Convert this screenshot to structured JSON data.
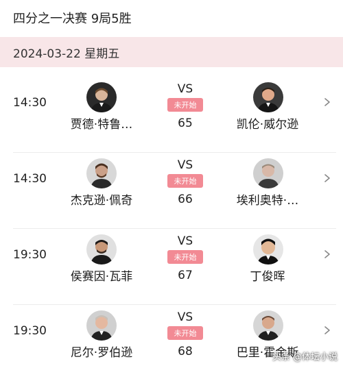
{
  "header": {
    "title": "四分之一决赛 9局5胜"
  },
  "date_bar": {
    "label": "2024-03-22 星期五"
  },
  "matches": [
    {
      "time": "14:30",
      "left_player": "贾德·特鲁…",
      "right_player": "凯伦·威尔逊",
      "vs": "VS",
      "status": "未开始",
      "number": "65"
    },
    {
      "time": "14:30",
      "left_player": "杰克逊·佩奇",
      "right_player": "埃利奥特·…",
      "vs": "VS",
      "status": "未开始",
      "number": "66"
    },
    {
      "time": "19:30",
      "left_player": "侯赛因·瓦菲",
      "right_player": "丁俊晖",
      "vs": "VS",
      "status": "未开始",
      "number": "67"
    },
    {
      "time": "19:30",
      "left_player": "尼尔·罗伯逊",
      "right_player": "巴里·霍金斯",
      "vs": "VS",
      "status": "未开始",
      "number": "68"
    }
  ],
  "watermark": "头条 @体坛小说",
  "colors": {
    "date_bar_bg": "#f8e6e8",
    "status_badge_bg": "#f28a94",
    "divider": "#ececec"
  },
  "icons": {
    "avatar": "player-avatar-photo",
    "chevron": "chevron-right-icon"
  }
}
